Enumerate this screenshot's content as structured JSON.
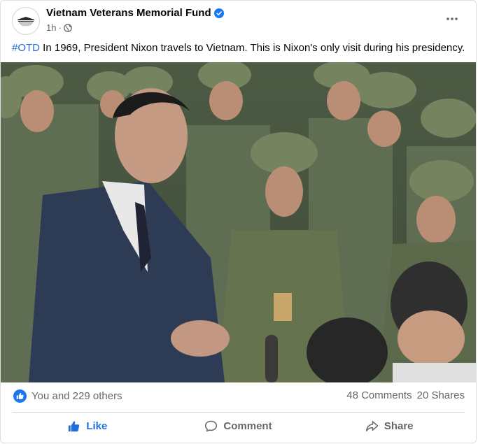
{
  "post": {
    "page_name": "Vietnam Veterans Memorial Fund",
    "time": "1h",
    "separator": "·",
    "audience_icon": "globe-icon",
    "verified_icon": "verified-badge-icon",
    "more_icon": "ellipsis-icon",
    "caption": {
      "hashtag": "#OTD",
      "text": " In 1969, President Nixon travels to Vietnam. This is Nixon's only visit during his presidency."
    },
    "avatar_text": "VIETNAM VETERANS MEMORIAL FUND"
  },
  "engagement": {
    "reaction_icon": "like-reaction-icon",
    "reactions_text": "You and 229 others",
    "comments": "48 Comments",
    "shares": "20 Shares"
  },
  "actions": {
    "like": "Like",
    "comment": "Comment",
    "share": "Share"
  },
  "colors": {
    "accent": "#216fdb",
    "secondary_text": "#65676b",
    "divider": "#ced0d4"
  }
}
